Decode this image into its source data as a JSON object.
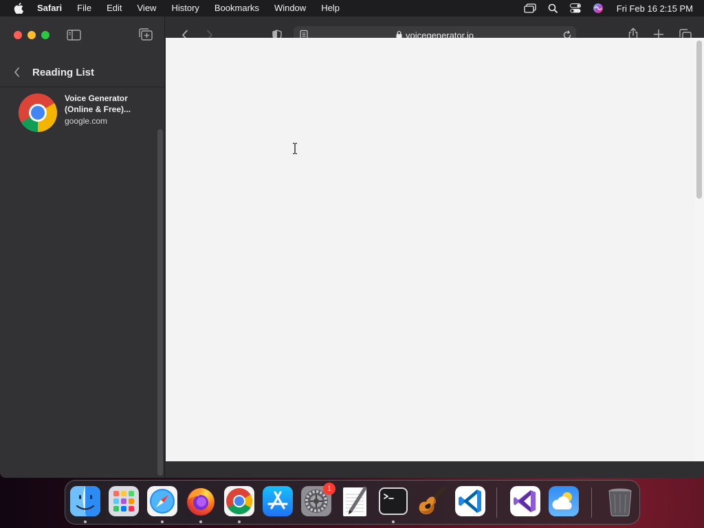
{
  "menubar": {
    "app_name": "Safari",
    "menus": [
      "File",
      "Edit",
      "View",
      "History",
      "Bookmarks",
      "Window",
      "Help"
    ],
    "clock": "Fri Feb 16  2:15 PM"
  },
  "sidebar": {
    "title": "Reading List",
    "items": [
      {
        "title_line1": "Voice Generator",
        "title_line2": "(Online & Free)...",
        "domain": "google.com"
      }
    ]
  },
  "toolbar": {
    "url": "voicegenerator.io"
  },
  "dock": {
    "apps": [
      "Finder",
      "Launchpad",
      "Safari",
      "Firefox",
      "Google Chrome",
      "App Store",
      "System Settings",
      "TextEdit",
      "Terminal",
      "GarageBand",
      "Visual Studio Code",
      "Visual Studio",
      "Weather",
      "Trash"
    ],
    "system_settings_badge": "1"
  },
  "colors": {
    "menubar_bg": "#1d1c1f",
    "sidebar_bg": "#323234",
    "content_bg": "#f3f3f3",
    "close": "#ff5f57",
    "minimize": "#febc2e",
    "maximize": "#28c840"
  }
}
